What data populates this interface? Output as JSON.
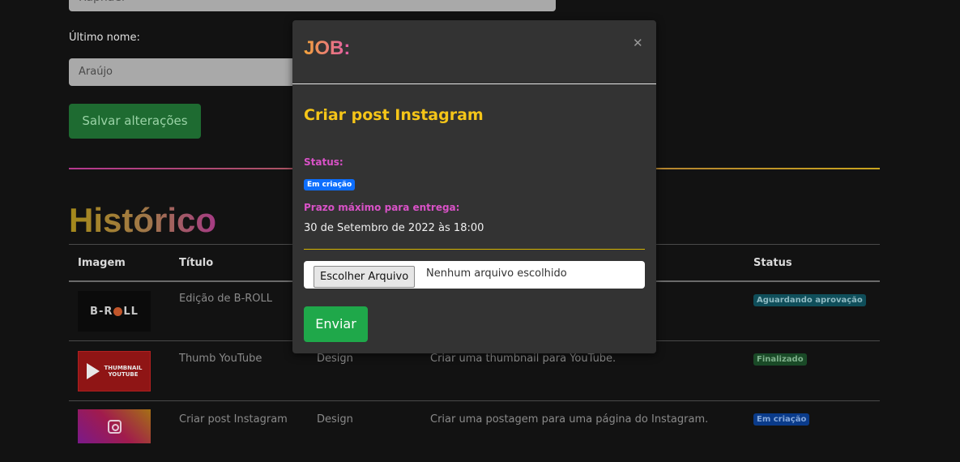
{
  "profile": {
    "first_name_value": "Raphael",
    "last_name_label": "Último nome:",
    "last_name_value": "Araújo",
    "save_button": "Salvar alterações"
  },
  "history": {
    "title": "Histórico",
    "columns": [
      "Imagem",
      "Título",
      "Status"
    ],
    "rows": [
      {
        "thumb": "B-ROLL",
        "title": "Edição de B-ROLL",
        "category": "",
        "description": "",
        "status": "Aguardando aprovação"
      },
      {
        "thumb": "THUMBNAIL YOUTUBE",
        "title": "Thumb YouTube",
        "category": "Design",
        "description": "Criar uma thumbnail para YouTube.",
        "status": "Finalizado"
      },
      {
        "thumb": "instagram",
        "title": "Criar post Instagram",
        "category": "Design",
        "description": "Criar uma postagem para uma página do Instagram.",
        "status": "Em criação"
      }
    ]
  },
  "modal": {
    "heading": "JOB:",
    "close_glyph": "✕",
    "job_name": "Criar post Instagram",
    "status_label": "Status:",
    "status_value": "Em criação",
    "deadline_label": "Prazo máximo para entrega:",
    "deadline_value": "30 de Setembro de 2022 às 18:00",
    "file_button": "Escolher Arquivo",
    "file_status": "Nenhum arquivo escolhido",
    "submit_button": "Enviar"
  },
  "colors": {
    "background": "#121212",
    "modal": "#333333",
    "accent_yellow": "#f5c518",
    "accent_pink": "#d952c7",
    "submit_green": "#1fa84a",
    "status_blue": "#0d6efd"
  }
}
